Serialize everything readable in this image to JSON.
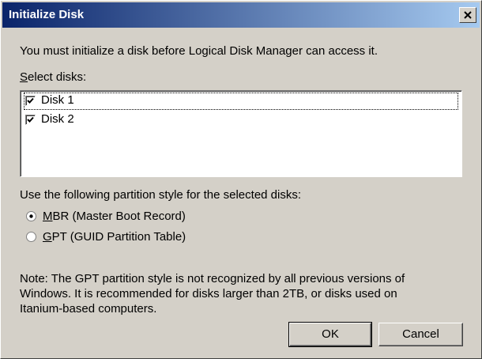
{
  "window": {
    "title": "Initialize Disk"
  },
  "intro_text": "You must initialize a disk before Logical Disk Manager can access it.",
  "select_label": {
    "accel": "S",
    "rest": "elect disks:"
  },
  "disks": [
    {
      "label": "Disk 1",
      "checked": true
    },
    {
      "label": "Disk 2",
      "checked": true
    }
  ],
  "partition_label": "Use the following partition style for the selected disks:",
  "options": [
    {
      "accel": "M",
      "rest": "BR (Master Boot Record)",
      "selected": true
    },
    {
      "accel": "G",
      "rest": "PT (GUID Partition Table)",
      "selected": false
    }
  ],
  "note_lines": [
    "Note: The GPT partition style is not recognized by all previous versions of",
    "Windows. It is recommended for disks larger than 2TB, or disks used on",
    "Itanium-based computers."
  ],
  "buttons": {
    "ok": "OK",
    "cancel": "Cancel"
  },
  "icons": {
    "close": "close-icon",
    "check": "check-icon",
    "radio": "radio-icon"
  }
}
